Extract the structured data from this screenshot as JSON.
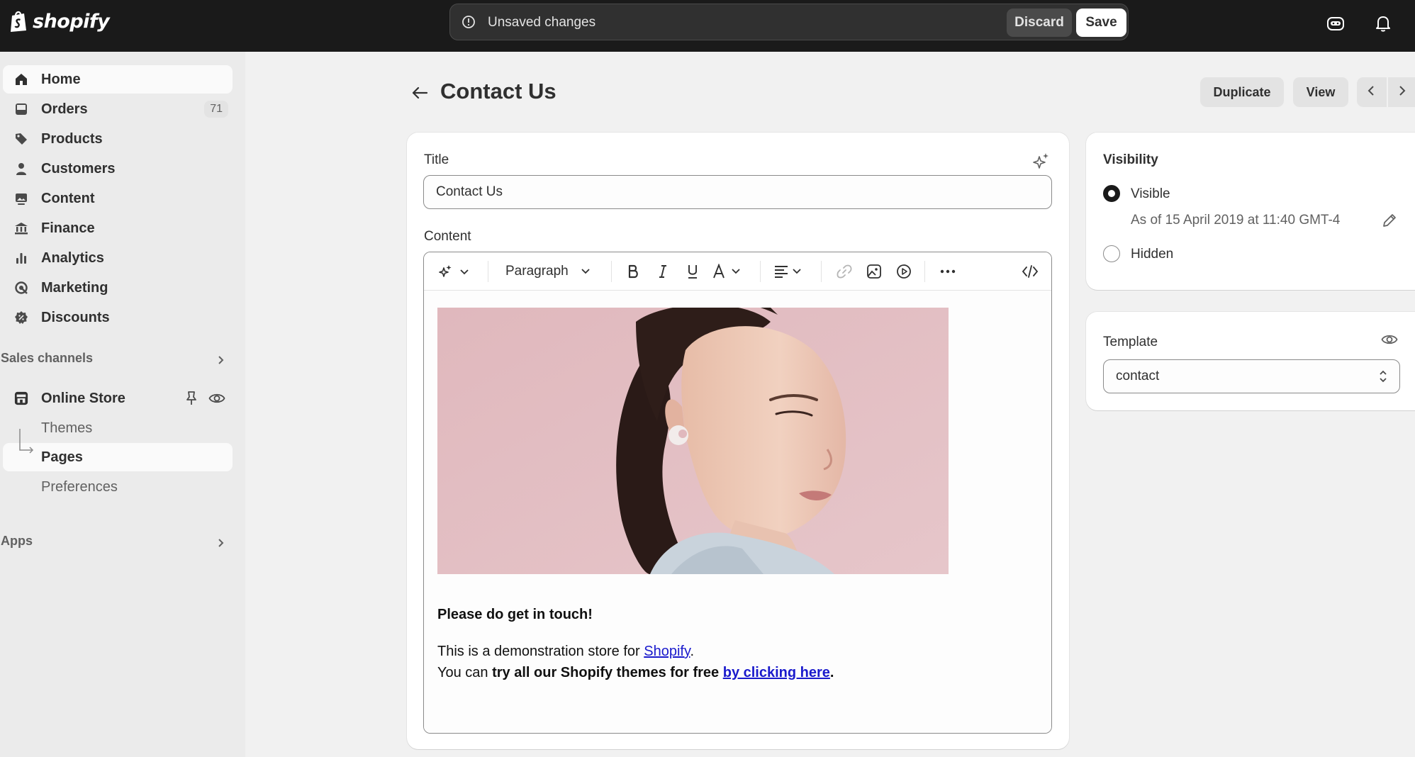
{
  "topbar": {
    "logo_text": "shopify",
    "unsaved_text": "Unsaved changes",
    "discard_label": "Discard",
    "save_label": "Save",
    "icons": [
      "alert-circle-icon",
      "assistant-icon",
      "bell-icon"
    ]
  },
  "sidebar": {
    "items": [
      {
        "label": "Home",
        "icon": "home-icon"
      },
      {
        "label": "Orders",
        "icon": "inbox-icon",
        "badge": "71"
      },
      {
        "label": "Products",
        "icon": "tag-icon"
      },
      {
        "label": "Customers",
        "icon": "person-icon"
      },
      {
        "label": "Content",
        "icon": "image-stack-icon"
      },
      {
        "label": "Finance",
        "icon": "bank-icon"
      },
      {
        "label": "Analytics",
        "icon": "bar-chart-icon"
      },
      {
        "label": "Marketing",
        "icon": "target-icon"
      },
      {
        "label": "Discounts",
        "icon": "discount-icon"
      }
    ],
    "sales_channels_label": "Sales channels",
    "online_store_label": "Online Store",
    "sub_items": [
      "Themes",
      "Pages",
      "Preferences"
    ],
    "apps_label": "Apps"
  },
  "page": {
    "title": "Contact Us",
    "duplicate_label": "Duplicate",
    "view_label": "View"
  },
  "form": {
    "title_label": "Title",
    "title_value": "Contact Us",
    "content_label": "Content",
    "toolbar": {
      "paragraph_label": "Paragraph"
    },
    "body": {
      "heading": "Please do get in touch!",
      "line1_prefix": "This is a demonstration store for ",
      "line1_link": "Shopify",
      "line1_suffix": ".",
      "line2_prefix": "You can ",
      "line2_bold": "try all our Shopify themes for free ",
      "line2_link": "by clicking here",
      "line2_suffix": "."
    }
  },
  "visibility": {
    "title": "Visibility",
    "visible_label": "Visible",
    "visible_date": "As of 15 April 2019 at 11:40 GMT-4",
    "hidden_label": "Hidden",
    "selected": "Visible"
  },
  "template": {
    "title": "Template",
    "value": "contact"
  },
  "colors": {
    "topbar_bg": "#1a1a1a",
    "page_bg": "#f1f1f1",
    "sidebar_bg": "#ebebeb",
    "link": "#1a1acc"
  }
}
